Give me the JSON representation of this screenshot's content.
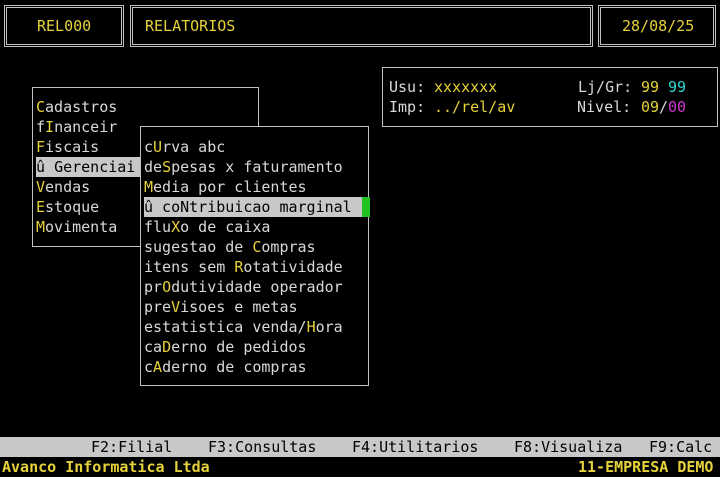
{
  "header": {
    "program_code": "REL000",
    "title": "RELATORIOS",
    "date": "28/08/25"
  },
  "info": {
    "usu_label": "Usu:",
    "usu_value": "xxxxxxx",
    "imp_label": "Imp:",
    "imp_value": "../rel/av",
    "ljgr_label": "Lj/Gr:",
    "lj_value": "99",
    "gr_value": "99",
    "nivel_label": "Nivel:",
    "nivel_value": "09",
    "nivel_slash": "/",
    "nivel_value2": "00"
  },
  "main_menu": {
    "items": [
      {
        "pre": "",
        "hot": "C",
        "post": "adastros"
      },
      {
        "pre": "f",
        "hot": "I",
        "post": "nanceir"
      },
      {
        "pre": "",
        "hot": "F",
        "post": "iscais"
      },
      {
        "pre": "û ",
        "hot": "G",
        "post": "erenciai"
      },
      {
        "pre": "",
        "hot": "V",
        "post": "endas"
      },
      {
        "pre": "",
        "hot": "E",
        "post": "stoque"
      },
      {
        "pre": "",
        "hot": "M",
        "post": "ovimenta"
      }
    ]
  },
  "sub_menu": {
    "items": [
      {
        "pre": "c",
        "hot": "U",
        "post": "rva abc"
      },
      {
        "pre": "de",
        "hot": "S",
        "post": "pesas x faturamento"
      },
      {
        "pre": "",
        "hot": "M",
        "post": "edia por clientes"
      },
      {
        "pre": "û co",
        "hot": "N",
        "post": "tribuicao marginal"
      },
      {
        "pre": "flu",
        "hot": "X",
        "post": "o de caixa"
      },
      {
        "pre": "sugestao de ",
        "hot": "C",
        "post": "ompras"
      },
      {
        "pre": "itens sem ",
        "hot": "R",
        "post": "otatividade"
      },
      {
        "pre": "pr",
        "hot": "O",
        "post": "dutividade operador"
      },
      {
        "pre": "pre",
        "hot": "V",
        "post": "isoes e metas"
      },
      {
        "pre": "estatistica venda/",
        "hot": "H",
        "post": "ora"
      },
      {
        "pre": "ca",
        "hot": "D",
        "post": "erno de pedidos"
      },
      {
        "pre": "c",
        "hot": "A",
        "post": "derno de compras"
      }
    ]
  },
  "function_keys": [
    "F2:Filial",
    "F3:Consultas",
    "F4:Utilitarios",
    "F8:Visualiza",
    "F9:Calc"
  ],
  "status": {
    "company": "Avanco Informatica Ltda",
    "empresa": "11-EMPRESA DEMO"
  },
  "colors": {
    "background": "#000000",
    "highlight_yellow": "#e6d23a",
    "selection_bg": "#c8c8c8",
    "cyan": "#2ed3d3",
    "magenta": "#d23ad2",
    "scroll_green": "#22c222"
  }
}
